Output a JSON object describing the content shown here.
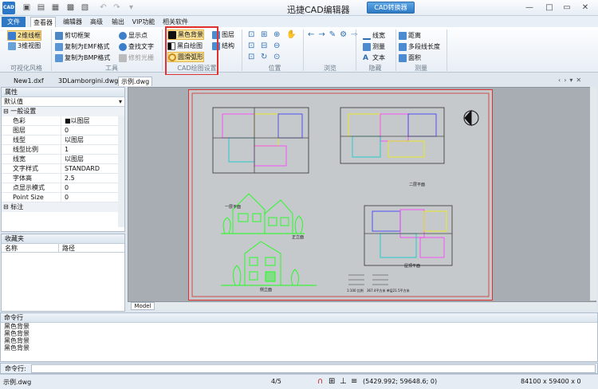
{
  "app": {
    "title": "迅捷CAD编辑器",
    "convert_btn": "CAD转换器",
    "icon_text": "CAD"
  },
  "tabs": [
    "文件",
    "查看器",
    "编辑器",
    "高级",
    "输出",
    "VIP功能",
    "相关软件"
  ],
  "ribbon": {
    "viz": {
      "b1": "2维线框",
      "b2": "3维视图",
      "label": "可视化风格"
    },
    "tools": {
      "b1": "剪切框架",
      "b2": "复制为EMF格式",
      "b3": "复制为BMP格式",
      "b4": "显示点",
      "b5": "查找文字",
      "b6": "修剪光栅",
      "label": "工具"
    },
    "cadset": {
      "b1": "黑色背景",
      "b2": "黑白绘图",
      "b3": "圆滑弧形",
      "b4": "图层",
      "b5": "结构",
      "label": "CAD绘图设置"
    },
    "pos": {
      "label": "位置"
    },
    "browse": {
      "label": "浏览"
    },
    "hide": {
      "b1": "线宽",
      "b2": "测量",
      "b3": "文本",
      "label": "隐藏"
    },
    "measure": {
      "b1": "距离",
      "b2": "多段线长度",
      "b3": "面积",
      "label": "测量"
    }
  },
  "doctabs": [
    "New1.dxf",
    "3DLamborgini.dwg",
    "示例.dwg"
  ],
  "props": {
    "title": "属性",
    "dropdown": "默认值",
    "section": "一般设置",
    "section2": "标注",
    "rows": [
      [
        "色彩",
        "■以图层"
      ],
      [
        "图层",
        "0"
      ],
      [
        "线型",
        "以图层"
      ],
      [
        "线型比例",
        "1"
      ],
      [
        "线宽",
        "以图层"
      ],
      [
        "文字样式",
        "STANDARD"
      ],
      [
        "字体高",
        "2.5"
      ],
      [
        "点显示模式",
        "0"
      ],
      [
        "Point Size",
        "0"
      ]
    ]
  },
  "fav": {
    "title": "收藏夹",
    "col1": "名称",
    "col2": "路径"
  },
  "canvas": {
    "model_tab": "Model",
    "labels": {
      "elev1": "一层平面",
      "plan2": "二层平面",
      "elev2": "正立面",
      "elev3": "侧立面",
      "plan3": "屋顶平面"
    },
    "notes": [
      "1:100 比例",
      "367.4平方米  单层21.5平方米"
    ]
  },
  "cmd": {
    "title": "命令行",
    "lines": [
      "黑色背景",
      "黑色背景",
      "黑色背景",
      "黑色背景"
    ],
    "prompt": "命令行:"
  },
  "status": {
    "file": "示例.dwg",
    "page": "4/5",
    "coords": "(5429.992; 59648.6; 0)",
    "size": "84100 x 59400 x 0"
  }
}
